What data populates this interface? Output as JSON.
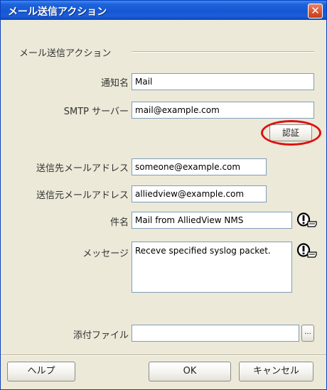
{
  "window": {
    "title": "メール送信アクション",
    "close_glyph": "✕"
  },
  "group": {
    "title": "メール送信アクション"
  },
  "form": {
    "notification_name": {
      "label": "通知名",
      "value": "Mail"
    },
    "smtp_server": {
      "label": "SMTP サーバー",
      "value": "mail@example.com"
    },
    "auth_button": "認証",
    "to_address": {
      "label": "送信先メールアドレス",
      "value": "someone@example.com"
    },
    "from_address": {
      "label": "送信元メールアドレス",
      "value": "alliedview@example.com"
    },
    "subject": {
      "label": "件名",
      "value": "Mail from AlliedView NMS"
    },
    "message": {
      "label": "メッセージ",
      "value": "Receve specified syslog packet."
    },
    "attachment": {
      "label": "添付ファイル",
      "value": "",
      "browse_label": "..."
    }
  },
  "footer": {
    "help_button": "ヘルプ",
    "ok_button": "OK",
    "cancel_button": "キャンセル"
  },
  "icons": {
    "subject_insert": "info-insert-icon",
    "message_insert": "info-insert-icon"
  },
  "colors": {
    "titlebar": "#1557d2",
    "close_button": "#d9522b",
    "dialog_background": "#ece9d8",
    "highlight_ring": "#dd1111"
  }
}
